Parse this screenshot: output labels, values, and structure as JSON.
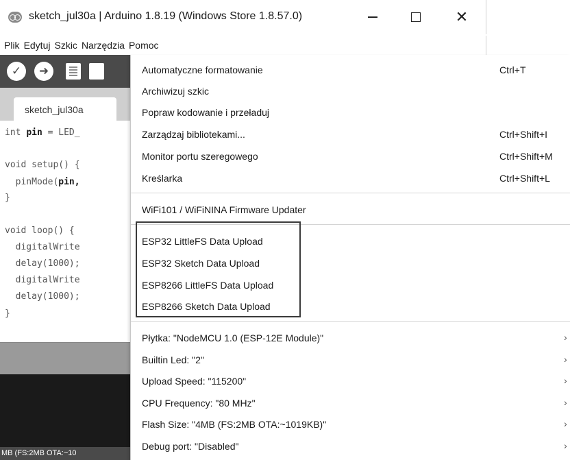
{
  "window": {
    "title": "sketch_jul30a | Arduino 1.8.19 (Windows Store 1.8.57.0)",
    "close_glyph": "✕"
  },
  "menubar": [
    "Plik",
    "Edytuj",
    "Szkic",
    "Narzędzia",
    "Pomoc"
  ],
  "toolbar": {
    "verify_glyph": "✓",
    "upload_glyph": "➜"
  },
  "tab": {
    "label": "sketch_jul30a"
  },
  "code": [
    {
      "text": "int ",
      "bold": "pin",
      "rest": " = LED_"
    },
    {
      "text": "",
      "bold": "",
      "rest": ""
    },
    {
      "text": "void setup() {",
      "bold": "",
      "rest": ""
    },
    {
      "text": "  pinMode(",
      "bold": "pin,",
      "rest": ""
    },
    {
      "text": "}",
      "bold": "",
      "rest": ""
    },
    {
      "text": "",
      "bold": "",
      "rest": ""
    },
    {
      "text": "void loop() {",
      "bold": "",
      "rest": ""
    },
    {
      "text": "  digitalWrite",
      "bold": "",
      "rest": ""
    },
    {
      "text": "  delay(1000);",
      "bold": "",
      "rest": ""
    },
    {
      "text": "  digitalWrite",
      "bold": "",
      "rest": ""
    },
    {
      "text": "  delay(1000);",
      "bold": "",
      "rest": ""
    },
    {
      "text": "}",
      "bold": "",
      "rest": ""
    }
  ],
  "status": {
    "text": "MB (FS:2MB OTA:~10"
  },
  "dropdown": {
    "items": [
      {
        "label": "Automatyczne formatowanie",
        "shortcut": "Ctrl+T"
      },
      {
        "label": "Archiwizuj szkic",
        "shortcut": ""
      },
      {
        "label": "Popraw kodowanie i przeładuj",
        "shortcut": ""
      },
      {
        "label": "Zarządzaj bibliotekami...",
        "shortcut": "Ctrl+Shift+I"
      },
      {
        "label": "Monitor portu szeregowego",
        "shortcut": "Ctrl+Shift+M"
      },
      {
        "label": "Kreślarka",
        "shortcut": "Ctrl+Shift+L"
      },
      {
        "label": "WiFi101 / WiFiNINA Firmware Updater",
        "shortcut": ""
      },
      {
        "label": "ESP32 LittleFS Data Upload",
        "shortcut": ""
      },
      {
        "label": "ESP32 Sketch Data Upload",
        "shortcut": ""
      },
      {
        "label": "ESP8266 LittleFS Data Upload",
        "shortcut": ""
      },
      {
        "label": "ESP8266 Sketch Data Upload",
        "shortcut": ""
      },
      {
        "label": "Płytka: \"NodeMCU 1.0 (ESP-12E Module)\"",
        "shortcut": ""
      },
      {
        "label": "Builtin Led: \"2\"",
        "shortcut": ""
      },
      {
        "label": "Upload Speed: \"115200\"",
        "shortcut": ""
      },
      {
        "label": "CPU Frequency: \"80 MHz\"",
        "shortcut": ""
      },
      {
        "label": "Flash Size: \"4MB (FS:2MB OTA:~1019KB)\"",
        "shortcut": ""
      },
      {
        "label": "Debug port: \"Disabled\"",
        "shortcut": ""
      }
    ],
    "submenu_arrow": "›"
  }
}
